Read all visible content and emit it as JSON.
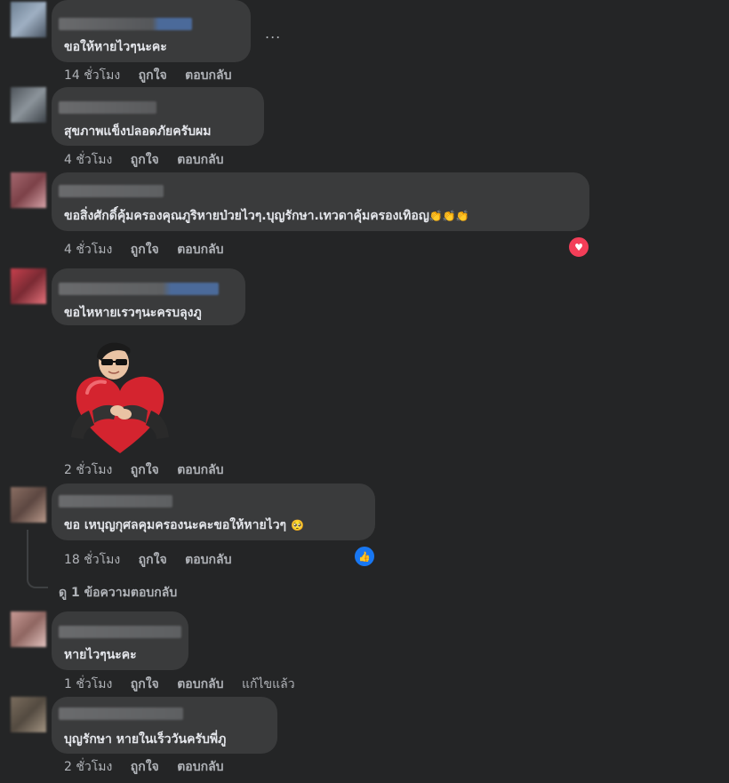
{
  "comments": [
    {
      "text": "ขอให้หายไวๆนะคะ",
      "time": "14 ชั่วโมง",
      "like": "ถูกใจ",
      "reply": "ตอบกลับ",
      "more": "..."
    },
    {
      "text": "สุขภาพแข็งปลอดภัยครับผม",
      "time": "4 ชั่วโมง",
      "like": "ถูกใจ",
      "reply": "ตอบกลับ"
    },
    {
      "text": "ขอสิ่งศักดิ์คุ้มครองคุณภูริหายป่วยไวๆ.บุญรักษา.เทวดาคุ้มครองเทิอญ",
      "emoji": "👏👏👏",
      "time": "4 ชั่วโมง",
      "like": "ถูกใจ",
      "reply": "ตอบกลับ",
      "reaction": "love"
    },
    {
      "text": "ขอไหหายเรวๆนะครบลุงภู",
      "time": "2 ชั่วโมง",
      "like": "ถูกใจ",
      "reply": "ตอบกลับ",
      "sticker": "heart-hug-sticker"
    },
    {
      "text": "ขอ เหบุญกุศลคุมครองนะคะขอให้หายไวๆ",
      "emoji": "🥺",
      "time": "18 ชั่วโมง",
      "like": "ถูกใจ",
      "reply": "ตอบกลับ",
      "reaction": "like",
      "view_replies": "ดู 1 ข้อความตอบกลับ"
    },
    {
      "text": "หายไวๆนะคะ",
      "time": "1 ชั่วโมง",
      "like": "ถูกใจ",
      "reply": "ตอบกลับ",
      "edited": "แก้ไขแล้ว"
    },
    {
      "text": "บุญรักษา หายในเร็ววันครับพี่ภู",
      "time": "2 ชั่วโมง",
      "like": "ถูกใจ",
      "reply": "ตอบกลับ"
    }
  ],
  "colors": {
    "background": "#242526",
    "bubble": "#3a3b3c",
    "text": "#e4e6eb",
    "secondary": "#b0b3b8",
    "love": "#f33e58",
    "like": "#1877f2"
  }
}
